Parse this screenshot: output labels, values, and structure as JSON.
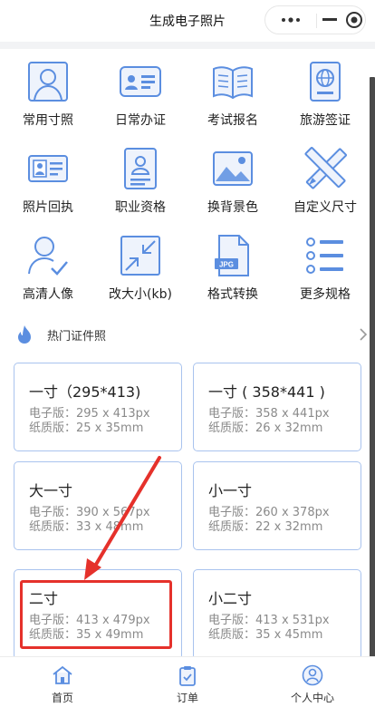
{
  "header": {
    "title": "生成电子照片"
  },
  "grid": [
    {
      "label": "常用寸照",
      "icon": "portrait-photo-icon"
    },
    {
      "label": "日常办证",
      "icon": "id-card-icon"
    },
    {
      "label": "考试报名",
      "icon": "open-book-icon"
    },
    {
      "label": "旅游签证",
      "icon": "passport-icon"
    },
    {
      "label": "照片回执",
      "icon": "receipt-card-icon"
    },
    {
      "label": "职业资格",
      "icon": "certificate-icon"
    },
    {
      "label": "换背景色",
      "icon": "landscape-image-icon"
    },
    {
      "label": "自定义尺寸",
      "icon": "pencil-ruler-icon"
    },
    {
      "label": "高清人像",
      "icon": "user-check-icon"
    },
    {
      "label": "改大小(kb)",
      "icon": "resize-arrows-icon"
    },
    {
      "label": "格式转换",
      "icon": "jpg-file-icon"
    },
    {
      "label": "更多规格",
      "icon": "list-icon"
    }
  ],
  "hot": {
    "title": "热门证件照"
  },
  "cards": [
    {
      "title": "一寸（295*413)",
      "digital": "电子版：295 x 413px",
      "print": "纸质版：25 x 35mm"
    },
    {
      "title": "一寸 ( 358*441 )",
      "digital": "电子版：358 x 441px",
      "print": "纸质版：26 x 32mm"
    },
    {
      "title": "大一寸",
      "digital": "电子版：390 x 567px",
      "print": "纸质版：33 x 48mm"
    },
    {
      "title": "小一寸",
      "digital": "电子版：260 x 378px",
      "print": "纸质版：22 x 32mm"
    },
    {
      "title": "二寸",
      "digital": "电子版：413 x 479px",
      "print": "纸质版：35 x 49mm"
    },
    {
      "title": "小二寸",
      "digital": "电子版：413 x 531px",
      "print": "纸质版：35 x 45mm"
    }
  ],
  "tabs": [
    {
      "label": "首页",
      "icon": "home-icon"
    },
    {
      "label": "订单",
      "icon": "clipboard-check-icon"
    },
    {
      "label": "个人中心",
      "icon": "user-icon"
    }
  ],
  "colors": {
    "accent": "#5b8ee0",
    "card_border": "#a9c3ee",
    "annotation_red": "#e5312b"
  }
}
